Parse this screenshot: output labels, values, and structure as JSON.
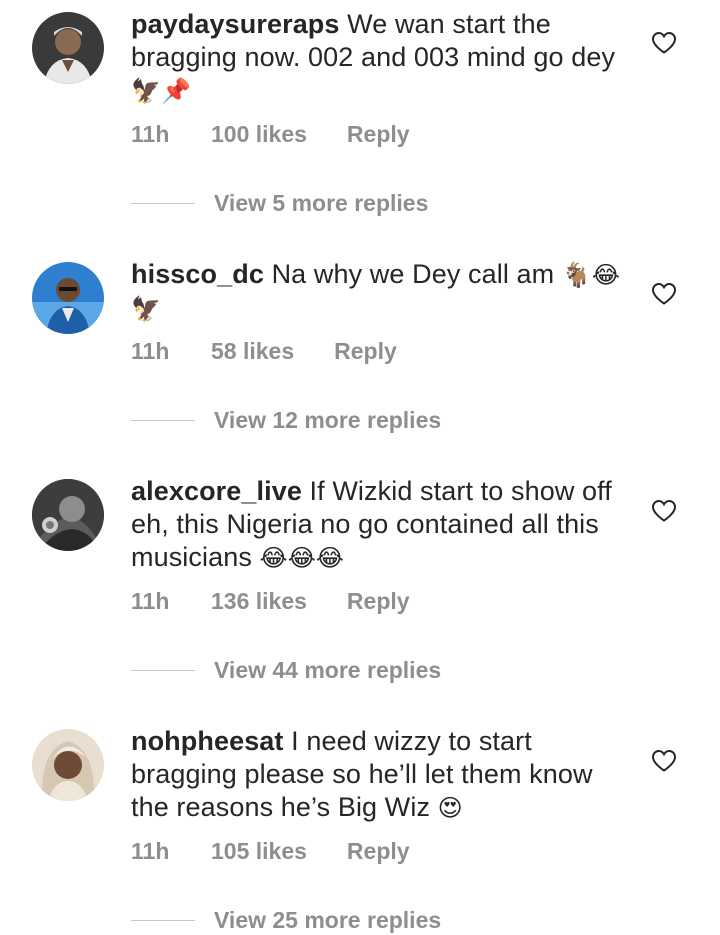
{
  "comments": [
    {
      "username": "paydaysureraps",
      "text": "We wan start the bragging now. 002 and 003 mind go dey",
      "emoji": "🦅📌",
      "time": "11h",
      "likes": "100 likes",
      "reply": "Reply",
      "view_replies": "View 5 more replies"
    },
    {
      "username": "hissco_dc",
      "text": "Na why we Dey call am",
      "emoji": "🐐😂🦅",
      "time": "11h",
      "likes": "58 likes",
      "reply": "Reply",
      "view_replies": "View 12 more replies"
    },
    {
      "username": "alexcore_live",
      "text": "If Wizkid start to show off eh, this Nigeria no go contained all this musicians",
      "emoji": "😂😂😂",
      "time": "11h",
      "likes": "136 likes",
      "reply": "Reply",
      "view_replies": "View 44 more replies"
    },
    {
      "username": "nohpheesat",
      "text": "I need wizzy to start bragging please so he’ll let them know the reasons he’s Big Wiz",
      "emoji": "😍",
      "time": "11h",
      "likes": "105 likes",
      "reply": "Reply",
      "view_replies": "View 25 more replies"
    }
  ],
  "icons": {
    "like": "heart-outline-icon"
  },
  "colors": {
    "text": "#262626",
    "meta": "#8e8e8e",
    "divider": "#c7c7c7"
  }
}
